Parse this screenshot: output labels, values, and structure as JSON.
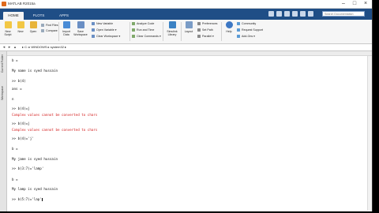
{
  "window": {
    "title": "MATLAB R2015a",
    "controls": {
      "minimize": "‒",
      "maximize": "□",
      "close": "×"
    }
  },
  "tabs": [
    {
      "label": "HOME"
    },
    {
      "label": "PLOTS"
    },
    {
      "label": "APPS"
    }
  ],
  "search": {
    "placeholder": "Search Documentation"
  },
  "toolstrip": {
    "buttons": [
      {
        "label": "New\nScript",
        "icon": "new-script-icon",
        "color": "#f2c744"
      },
      {
        "label": "New",
        "icon": "new-icon",
        "color": "#f2c744"
      },
      {
        "label": "Open",
        "icon": "open-folder-icon",
        "color": "#e8b43a"
      },
      {
        "label": "Import\nData",
        "icon": "import-data-icon",
        "color": "#4a8cd6"
      },
      {
        "label": "Save\nWorkspace",
        "icon": "save-workspace-icon",
        "color": "#6a8fc4"
      },
      {
        "label": "Simulink\nLibrary",
        "icon": "simulink-icon",
        "color": "#3b82c4"
      },
      {
        "label": "Layout",
        "icon": "layout-icon",
        "color": "#7a9cc6"
      },
      {
        "label": "Help",
        "icon": "help-icon",
        "color": "#3d78c4"
      }
    ],
    "file_rows": [
      {
        "label": "Find Files",
        "icon": "find-files-icon"
      },
      {
        "label": "Compare",
        "icon": "compare-icon"
      }
    ],
    "variable_rows": [
      {
        "label": "New Variable",
        "icon": "new-variable-icon"
      },
      {
        "label": "Open Variable ▾",
        "icon": "open-variable-icon"
      },
      {
        "label": "Clear Workspace ▾",
        "icon": "clear-workspace-icon"
      }
    ],
    "code_rows": [
      {
        "label": "Analyze Code",
        "icon": "analyze-code-icon"
      },
      {
        "label": "Run and Time",
        "icon": "run-time-icon"
      },
      {
        "label": "Clear Commands ▾",
        "icon": "clear-commands-icon"
      }
    ],
    "env_rows": [
      {
        "label": "Preferences",
        "icon": "preferences-icon"
      },
      {
        "label": "Set Path",
        "icon": "set-path-icon"
      },
      {
        "label": "Parallel ▾",
        "icon": "parallel-icon"
      }
    ],
    "resource_rows": [
      {
        "label": "Community",
        "icon": "community-icon"
      },
      {
        "label": "Request Support",
        "icon": "request-support-icon"
      },
      {
        "label": "Add-Ons ▾",
        "icon": "add-ons-icon"
      }
    ]
  },
  "address_bar": {
    "path": "▸ C: ▸ WINDOWS ▸ system32 ▸"
  },
  "side_panel": {
    "current_folder": "Current Folder",
    "workspace": "Workspace"
  },
  "console": {
    "lines": [
      {
        "text": "b =",
        "type": "normal"
      },
      {
        "text": "My name is syed hussain",
        "type": "normal"
      },
      {
        "text": ">> b(4)",
        "type": "normal"
      },
      {
        "text": "ans =",
        "type": "normal"
      },
      {
        "text": "n",
        "type": "normal"
      },
      {
        "text": ">> b(4)=j",
        "type": "normal"
      },
      {
        "text": "Complex values cannot be converted to chars",
        "type": "error"
      },
      {
        "text": ">> b(4)=j",
        "type": "normal"
      },
      {
        "text": "Complex values cannot be converted to chars",
        "type": "error"
      },
      {
        "text": ">> b(4)='j'",
        "type": "normal"
      },
      {
        "text": "b =",
        "type": "normal"
      },
      {
        "text": "My jame is syed hussain",
        "type": "normal"
      },
      {
        "text": ">> b(3:7)='lamp'",
        "type": "normal"
      },
      {
        "text": "b =",
        "type": "normal"
      },
      {
        "text": "My lamp is syed hussain",
        "type": "normal"
      },
      {
        "text": ">> b(5:7)='lap'",
        "type": "normal"
      }
    ]
  }
}
